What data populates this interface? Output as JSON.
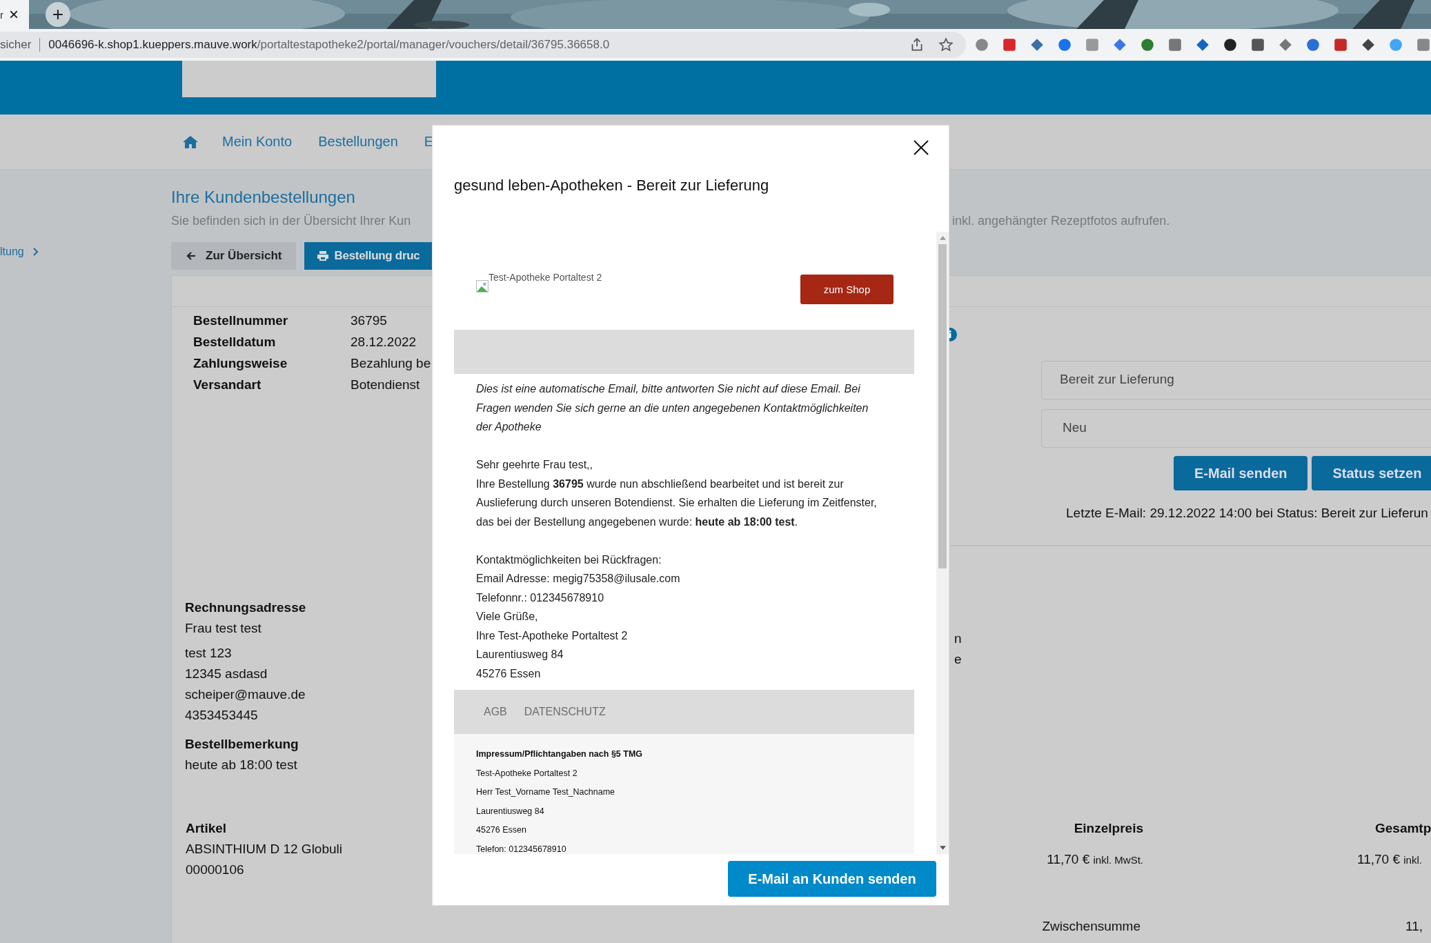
{
  "browser": {
    "tab_title": "r",
    "tab_close": "×",
    "new_tab": "+",
    "security": "sicher",
    "url_host": "0046696-k.shop1.kueppers.mauve.work",
    "url_path": "/portaltestapotheke2/portal/manager/vouchers/detail/36795.36658.0"
  },
  "nav": {
    "items": [
      "Mein Konto",
      "Bestellungen",
      "E"
    ]
  },
  "sidebar": {
    "item": "ltung"
  },
  "page": {
    "title": "Ihre Kundenbestellungen",
    "subtitle_left": "Sie befinden sich in der Übersicht Ihrer Kun",
    "subtitle_right": "inkl. angehängter Rezeptfotos aufrufen."
  },
  "actions": [
    {
      "label": "Zur Übersicht",
      "kind": "back"
    },
    {
      "label": "Bestellung druc",
      "kind": "print"
    }
  ],
  "order_details": [
    {
      "label": "Bestellnummer",
      "value": "36795"
    },
    {
      "label": "Bestelldatum",
      "value": "28.12.2022"
    },
    {
      "label": "Zahlungsweise",
      "value": "Bezahlung be"
    },
    {
      "label": "Versandart",
      "value": "Botendienst"
    }
  ],
  "billing_address": {
    "heading": "Rechnungsadresse",
    "name": "Frau test test",
    "lines": [
      "test 123",
      "12345 asdasd",
      "scheiper@mauve.de",
      "4353453445"
    ]
  },
  "order_note": {
    "heading": "Bestellbemerkung",
    "text": "heute ab 18:00 test"
  },
  "article": {
    "heading": "Artikel",
    "name": "ABSINTHIUM D 12 Globuli",
    "number": "00000106"
  },
  "status_panel": {
    "status_select": "Bereit zur Lieferung",
    "second_select": "Neu",
    "buttons": [
      "E-Mail senden",
      "Status setzen"
    ],
    "last_email": "Letzte E-Mail: 29.12.2022 14:00 bei Status: Bereit zur Lieferun"
  },
  "cut_fragments": [
    "n",
    "e"
  ],
  "price_table": {
    "columns": [
      "Einzelpreis",
      "Gesamtp"
    ],
    "cells": [
      {
        "price": "11,70 €",
        "note": "inkl. MwSt."
      },
      {
        "price": "11,70 €",
        "note": "inkl."
      }
    ],
    "subtotal_label": "Zwischensumme",
    "subtotal_value": "11,"
  },
  "modal": {
    "title": "gesund leben-Apotheken - Bereit zur Lieferung",
    "email": {
      "logo_alt": "Test-Apotheke Portaltest 2",
      "shop_button": "zum Shop",
      "notice": "Dies ist eine automatische Email, bitte antworten Sie nicht auf diese Email. Bei Fragen wenden Sie sich gerne an die unten angegebenen Kontaktmöglichkeiten der Apotheke",
      "greeting": "Sehr geehrte Frau test,,",
      "body": "Ihre Bestellung **36795** wurde nun abschließend bearbeitet und ist bereit zur Auslieferung durch unseren Botendienst. Sie erhalten die Lieferung im Zeitfenster, das bei der Bestellung angegebenen wurde: **heute ab 18:00 test**.",
      "contact_lines": [
        "Kontaktmöglichkeiten bei Rückfragen:",
        "Email Adresse: megig75358@ilusale.com",
        "Telefonnr.: 012345678910",
        "Viele Grüße,",
        "Ihre Test-Apotheke Portaltest 2",
        "Laurentiusweg 84",
        "45276 Essen"
      ],
      "footer_links": [
        "AGB",
        "DATENSCHUTZ"
      ],
      "impressum_heading": "Impressum/Pflichtangaben nach §5 TMG",
      "impressum_lines": [
        "Test-Apotheke Portaltest 2",
        "Herr  Test_Vorname Test_Nachname",
        "Laurentiusweg 84",
        "45276 Essen",
        "Telefon: 012345678910"
      ]
    },
    "send_button": "E-Mail an Kunden senden"
  }
}
